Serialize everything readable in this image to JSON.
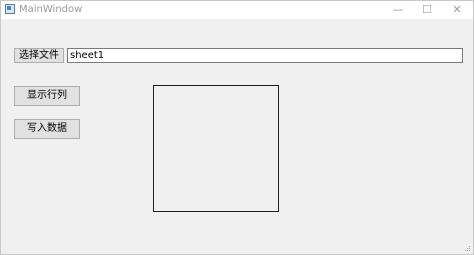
{
  "window": {
    "title": "MainWindow",
    "minimize_glyph": "—",
    "maximize_glyph": "☐",
    "close_glyph": "✕"
  },
  "file_row": {
    "choose_button_label": "选择文件",
    "file_input_value": "sheet1"
  },
  "actions": {
    "show_rows_cols_label": "显示行列",
    "write_data_label": "写入数据"
  }
}
